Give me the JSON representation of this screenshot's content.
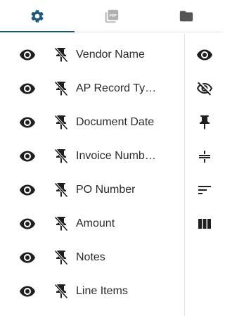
{
  "tabs": [
    {
      "name": "settings",
      "icon": "gear-icon",
      "active": true
    },
    {
      "name": "pdf",
      "icon": "pdf-icon",
      "active": false
    },
    {
      "name": "folder",
      "icon": "folder-icon",
      "active": false
    }
  ],
  "fields": [
    {
      "label": "Vendor Name",
      "visible": true,
      "pinned": false
    },
    {
      "label": "AP Record Ty…",
      "visible": true,
      "pinned": false
    },
    {
      "label": "Document Date",
      "visible": true,
      "pinned": false
    },
    {
      "label": "Invoice Numb…",
      "visible": true,
      "pinned": false
    },
    {
      "label": "PO Number",
      "visible": true,
      "pinned": false
    },
    {
      "label": "Amount",
      "visible": true,
      "pinned": false
    },
    {
      "label": "Notes",
      "visible": true,
      "pinned": false
    },
    {
      "label": "Line Items",
      "visible": true,
      "pinned": false
    }
  ],
  "side_actions": [
    {
      "name": "show-all",
      "icon": "eye-icon"
    },
    {
      "name": "hide-all",
      "icon": "eye-off-icon"
    },
    {
      "name": "pin",
      "icon": "pin-icon"
    },
    {
      "name": "strikethrough",
      "icon": "strikethrough-icon"
    },
    {
      "name": "sort",
      "icon": "sort-icon"
    },
    {
      "name": "columns",
      "icon": "columns-icon"
    }
  ],
  "colors": {
    "accent": "#1a5a7a",
    "icon_dark": "#1f1f1f",
    "tab_inactive": "#9e9e9e",
    "tab_folder": "#555555"
  }
}
